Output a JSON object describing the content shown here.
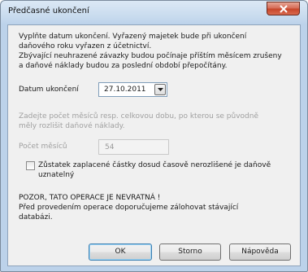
{
  "window": {
    "title": "Předčasné ukončení"
  },
  "intro": {
    "line1": "Vyplňte datum ukončení. Vyřazený majetek bude při ukončení",
    "line2": "daňového roku vyřazen z účetnictví.",
    "line3": "Zbývající neuhrazené závazky budou počínaje příštím měsícem zrušeny",
    "line4": "a daňové náklady budou za poslední období přepočítány."
  },
  "end_date": {
    "label": "Datum ukončení",
    "value": "27.10.2011"
  },
  "months_info": {
    "line1": "Zadejte počet měsíců resp. celkovou dobu, po kterou se původně",
    "line2": "měly rozlišit daňové náklady."
  },
  "months": {
    "label": "Počet měsíců",
    "value": "54"
  },
  "remainder_checkbox": {
    "line1": "Zůstatek zaplacené částky dosud časově nerozlišené je daňově",
    "line2": "uznatelný",
    "checked": false
  },
  "warning": {
    "line1": "POZOR, TATO OPERACE JE NEVRATNÁ !",
    "line2": "Před provedením operace doporučujeme zálohovat stávající",
    "line3": "databázi."
  },
  "buttons": {
    "ok": "OK",
    "cancel": "Storno",
    "help": "Nápověda"
  }
}
